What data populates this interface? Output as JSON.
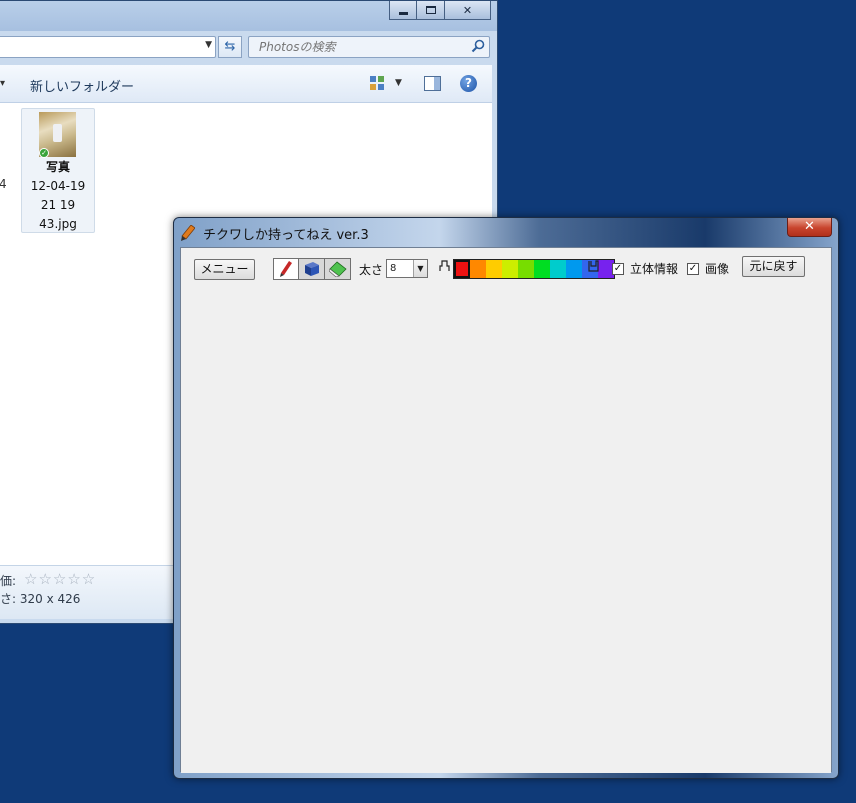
{
  "explorer": {
    "search_placeholder": "Photosの検索",
    "toolbar": {
      "new_folder": "新しいフォルダー"
    },
    "cut_text": "4",
    "file": {
      "title": "写真",
      "line2": "12-04-19",
      "line3": "21 19",
      "line4": "43.jpg"
    },
    "details": {
      "rating_label": "価:",
      "size_label": "さ:",
      "size_value": "320 x 426",
      "stars": "☆☆☆☆☆"
    },
    "help_glyph": "?",
    "close_glyph": "✕"
  },
  "app": {
    "title": "チクワしか持ってねえ ver.3",
    "close_glyph": "✕",
    "menu_button": "メニュー",
    "tools": [
      {
        "name": "pencil-tool",
        "icon": "pencil-icon"
      },
      {
        "name": "3d-tool",
        "icon": "box-icon"
      },
      {
        "name": "eraser-tool",
        "icon": "eraser-icon"
      }
    ],
    "size_label": "太さ",
    "size_value": "8",
    "palette_colors": [
      "#ee1111",
      "#ff8800",
      "#ffcc00",
      "#ccee00",
      "#77dd00",
      "#00dd22",
      "#00cccc",
      "#0099ee",
      "#3366ee",
      "#7722ee"
    ],
    "check_3d": {
      "label": "立体情報",
      "checked": true
    },
    "check_image": {
      "label": "画像",
      "checked": true
    },
    "reset_button": "元に戻す",
    "check_mark": "✓"
  }
}
